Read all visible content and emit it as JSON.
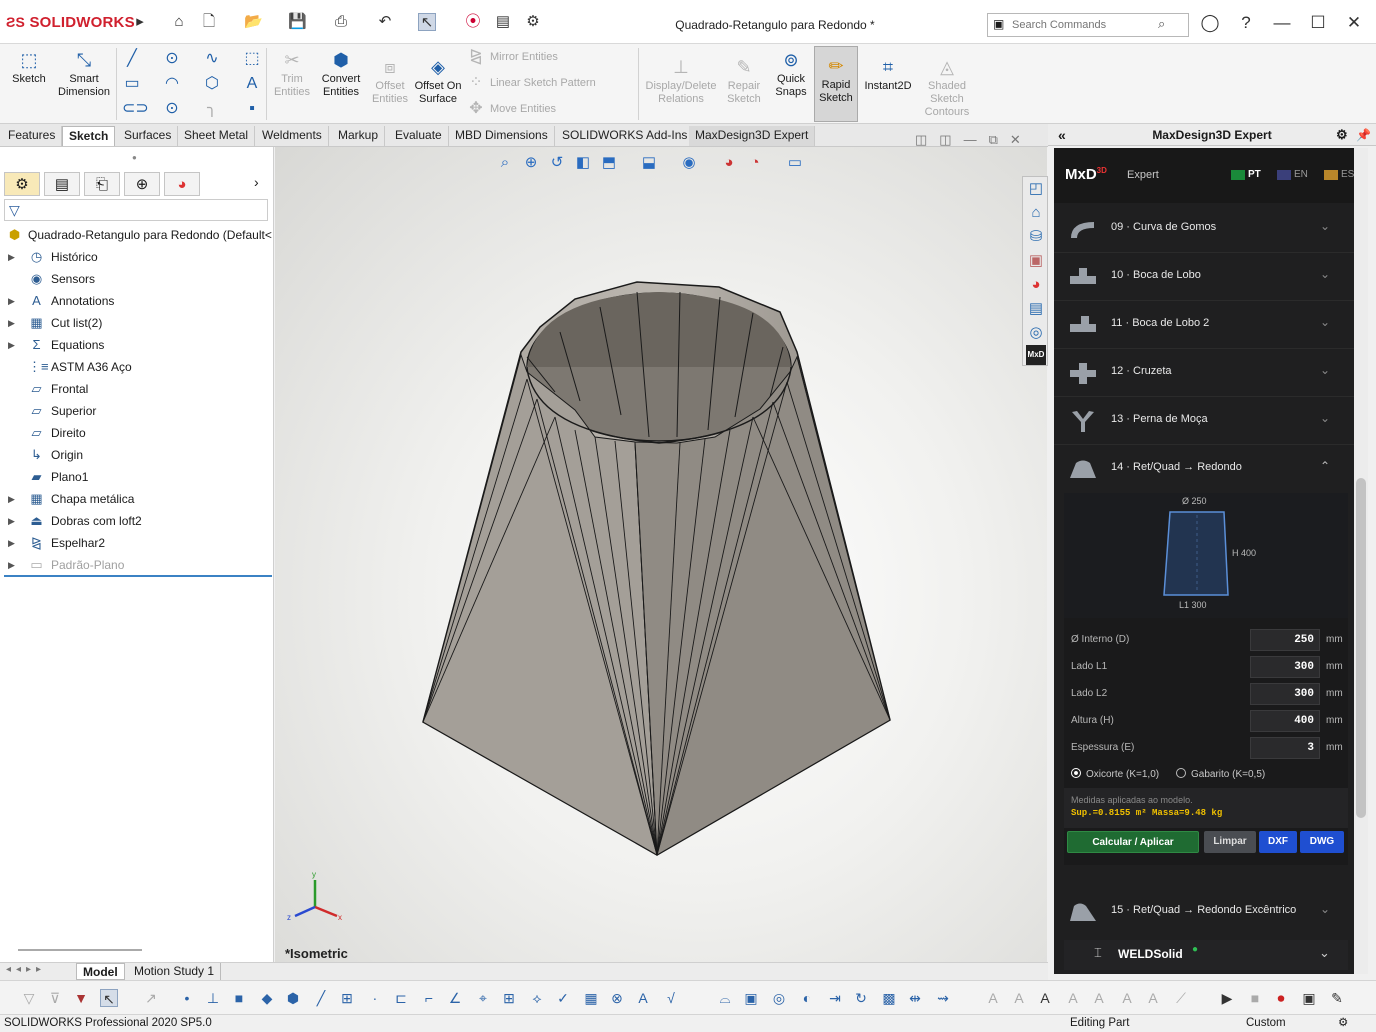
{
  "app": {
    "logo": "SOLIDWORKS",
    "document_title": "Quadrado-Retangulo para Redondo *"
  },
  "search": {
    "placeholder": "Search Commands"
  },
  "command_manager": {
    "sketch": "Sketch",
    "smart_dimension": "Smart Dimension",
    "trim_entities": "Trim Entities",
    "convert_entities": "Convert Entities",
    "offset_entities": "Offset Entities",
    "offset_on_surface": "Offset On Surface",
    "mirror_entities": "Mirror Entities",
    "linear_sketch_pattern": "Linear Sketch Pattern",
    "move_entities": "Move Entities",
    "display_delete_relations": "Display/Delete Relations",
    "repair_sketch": "Repair Sketch",
    "quick_snaps": "Quick Snaps",
    "rapid_sketch": "Rapid Sketch",
    "instant2d": "Instant2D",
    "shaded_sketch_contours": "Shaded Sketch Contours"
  },
  "tabs": [
    "Features",
    "Sketch",
    "Surfaces",
    "Sheet Metal",
    "Weldments",
    "Markup",
    "Evaluate",
    "MBD Dimensions",
    "SOLIDWORKS Add-Ins",
    "MaxDesign3D Expert"
  ],
  "tree": {
    "root": "Quadrado-Retangulo para Redondo  (Default<",
    "items": [
      "Histórico",
      "Sensors",
      "Annotations",
      "Cut list(2)",
      "Equations",
      "ASTM A36 Aço",
      "Frontal",
      "Superior",
      "Direito",
      "Origin",
      "Plano1",
      "Chapa metálica",
      "Dobras com loft2",
      "Espelhar2",
      "Padrão-Plano"
    ]
  },
  "viewport": {
    "view_label": "*Isometric",
    "axis_x": "x",
    "axis_y": "y",
    "axis_z": "z"
  },
  "right_panel": {
    "title": "MaxDesign3D Expert",
    "brand": "MxD",
    "brand_sup": "3D",
    "subtitle": "Expert",
    "languages": [
      "PT",
      "EN",
      "ES"
    ],
    "modules": [
      "09 · Curva de Gomos",
      "10 · Boca de Lobo",
      "11 · Boca de Lobo 2",
      "12 · Cruzeta",
      "13 · Perna de Moça",
      "14 · Ret/Quad → Redondo",
      "15 · Ret/Quad → Redondo Excêntrico"
    ],
    "diagram": {
      "diameter": "Ø 250",
      "height": "H 400",
      "side": "L1 300"
    },
    "fields": [
      {
        "label": "Ø Interno (D)",
        "value": "250",
        "unit": "mm"
      },
      {
        "label": "Lado L1",
        "value": "300",
        "unit": "mm"
      },
      {
        "label": "Lado L2",
        "value": "300",
        "unit": "mm"
      },
      {
        "label": "Altura (H)",
        "value": "400",
        "unit": "mm"
      },
      {
        "label": "Espessura (E)",
        "value": "3",
        "unit": "mm"
      }
    ],
    "radio_oxicorte": "Oxicorte (K=1,0)",
    "radio_gabarito": "Gabarito (K=0,5)",
    "result_note": "Medidas aplicadas ao modelo.",
    "result_values": "Sup.=0.8155 m²   Massa=9.48 kg",
    "btn_calc": "Calcular / Aplicar",
    "btn_clear": "Limpar",
    "btn_dxf": "DXF",
    "btn_dwg": "DWG",
    "weld": "WELDSolid"
  },
  "model_tabs": [
    "Model",
    "Motion Study 1"
  ],
  "status": {
    "left": "SOLIDWORKS Professional 2020 SP5.0",
    "mode": "Editing Part",
    "units": "Custom"
  }
}
